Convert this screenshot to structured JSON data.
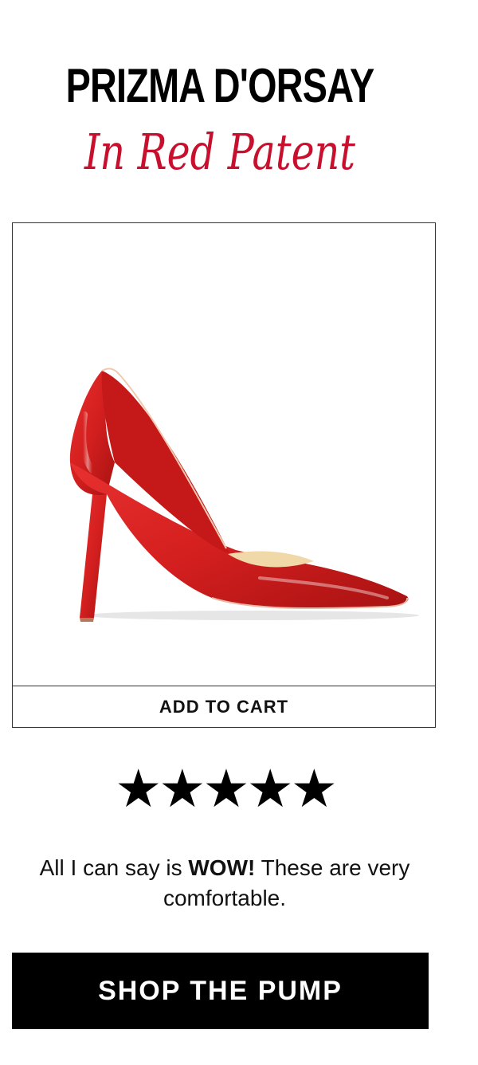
{
  "header": {
    "title": "PRIZMA D'ORSAY",
    "script_text": "In Red Patent",
    "script_color": "#c8102e"
  },
  "product": {
    "image_alt": "red patent d'orsay pump",
    "image_color": "#d41f1f",
    "add_to_cart_label": "ADD TO CART"
  },
  "review": {
    "rating": 5,
    "rating_max": 5,
    "stars_text": "★★★★★",
    "text_before": "All I can say is ",
    "text_bold": "WOW!",
    "text_after": " These are very comfortable."
  },
  "cta": {
    "label": "SHOP THE PUMP"
  }
}
